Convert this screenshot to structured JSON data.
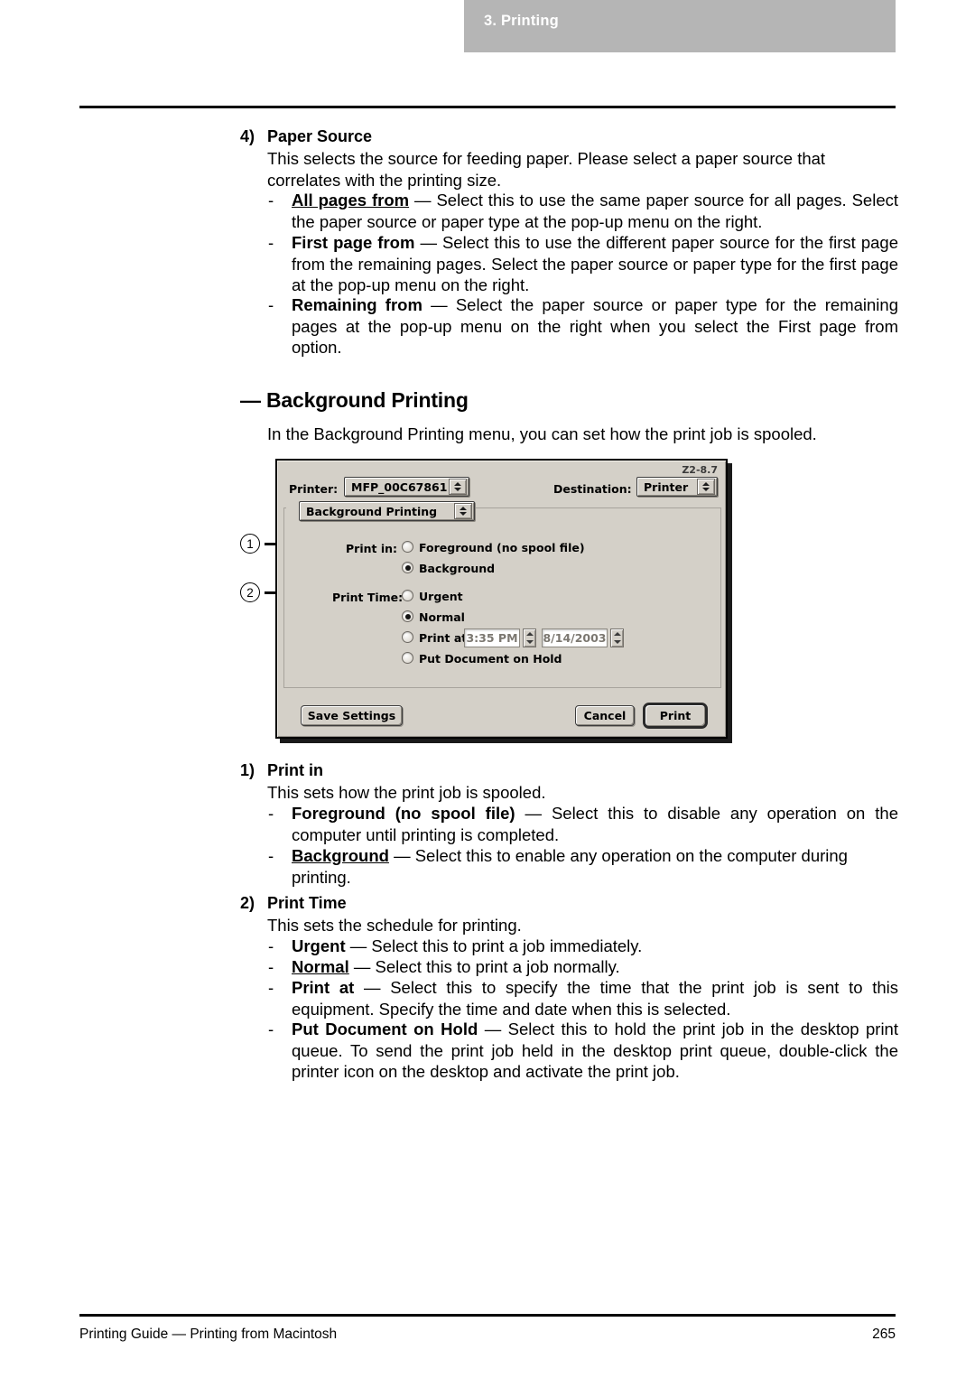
{
  "page": {
    "chapter_label": "3. Printing",
    "footer_left": "Printing Guide — Printing from Macintosh",
    "footer_page": "265"
  },
  "paper_source": {
    "number": "4)",
    "title": "Paper Source",
    "intro": "This selects the source for feeding paper. Please select a paper source that correlates with the printing size.",
    "items": [
      {
        "dash": "-",
        "label": "All pages from",
        "label_style": "underline-bold",
        "text": " — Select this to use the same paper source for all pages. Select the paper source or paper type at the pop-up menu on the right."
      },
      {
        "dash": "-",
        "label": "First page from",
        "label_style": "bold",
        "text": " — Select this to use the different paper source for the first page from the remaining pages.  Select the paper source or paper type for the first page at the pop-up menu on the right."
      },
      {
        "dash": "-",
        "label": "Remaining from",
        "label_style": "bold",
        "text": " — Select the paper source or paper type for the remaining pages at the pop-up menu on the right when you select the First page from option."
      }
    ]
  },
  "background_printing_section": {
    "heading_dash": "—",
    "heading": "Background Printing",
    "intro": "In the Background Printing menu, you can set how the print job is spooled."
  },
  "dialog": {
    "version": "Z2-8.7",
    "printer_label": "Printer:",
    "printer_value": "MFP_00C67861",
    "destination_label": "Destination:",
    "destination_value": "Printer",
    "pane_popup_value": "Background Printing",
    "print_in_label": "Print in:",
    "print_in_options": [
      {
        "label": "Foreground (no spool file)",
        "selected": false
      },
      {
        "label": "Background",
        "selected": true
      }
    ],
    "print_time_label": "Print Time:",
    "print_time_options": [
      {
        "label": "Urgent",
        "selected": false
      },
      {
        "label": "Normal",
        "selected": true
      },
      {
        "label": "Print at:",
        "selected": false
      },
      {
        "label": "Put Document on Hold",
        "selected": false
      }
    ],
    "print_at_time": "3:35 PM",
    "print_at_date": "8/14/2003",
    "save_settings_label": "Save Settings",
    "cancel_label": "Cancel",
    "print_label": "Print",
    "callouts": [
      {
        "number": "1"
      },
      {
        "number": "2"
      }
    ]
  },
  "print_in_section": {
    "number": "1)",
    "title": "Print in",
    "intro": "This sets how the print job is spooled.",
    "items": [
      {
        "dash": "-",
        "label": "Foreground (no spool file)",
        "label_style": "bold",
        "text": " — Select this to disable any operation on the computer until printing is completed."
      },
      {
        "dash": "-",
        "label": "Background",
        "label_style": "underline-bold",
        "text": " — Select this to enable any operation on the computer during printing."
      }
    ]
  },
  "print_time_section": {
    "number": "2)",
    "title": "Print Time",
    "intro": "This sets the schedule for printing.",
    "items": [
      {
        "dash": "-",
        "label": "Urgent",
        "label_style": "bold",
        "text": " — Select this to print a job immediately."
      },
      {
        "dash": "-",
        "label": "Normal",
        "label_style": "underline-bold",
        "text": " — Select this to print a job normally."
      },
      {
        "dash": "-",
        "label": "Print at",
        "label_style": "bold",
        "text": " — Select this to specify the time that the print job is sent to this equipment. Specify the time and date when this is selected."
      },
      {
        "dash": "-",
        "label": "Put Document on Hold",
        "label_style": "bold",
        "text": " — Select this to hold the print job in the desktop print queue. To send the print job held in the desktop print queue, double-click the printer icon on the desktop and activate the print job."
      }
    ]
  }
}
